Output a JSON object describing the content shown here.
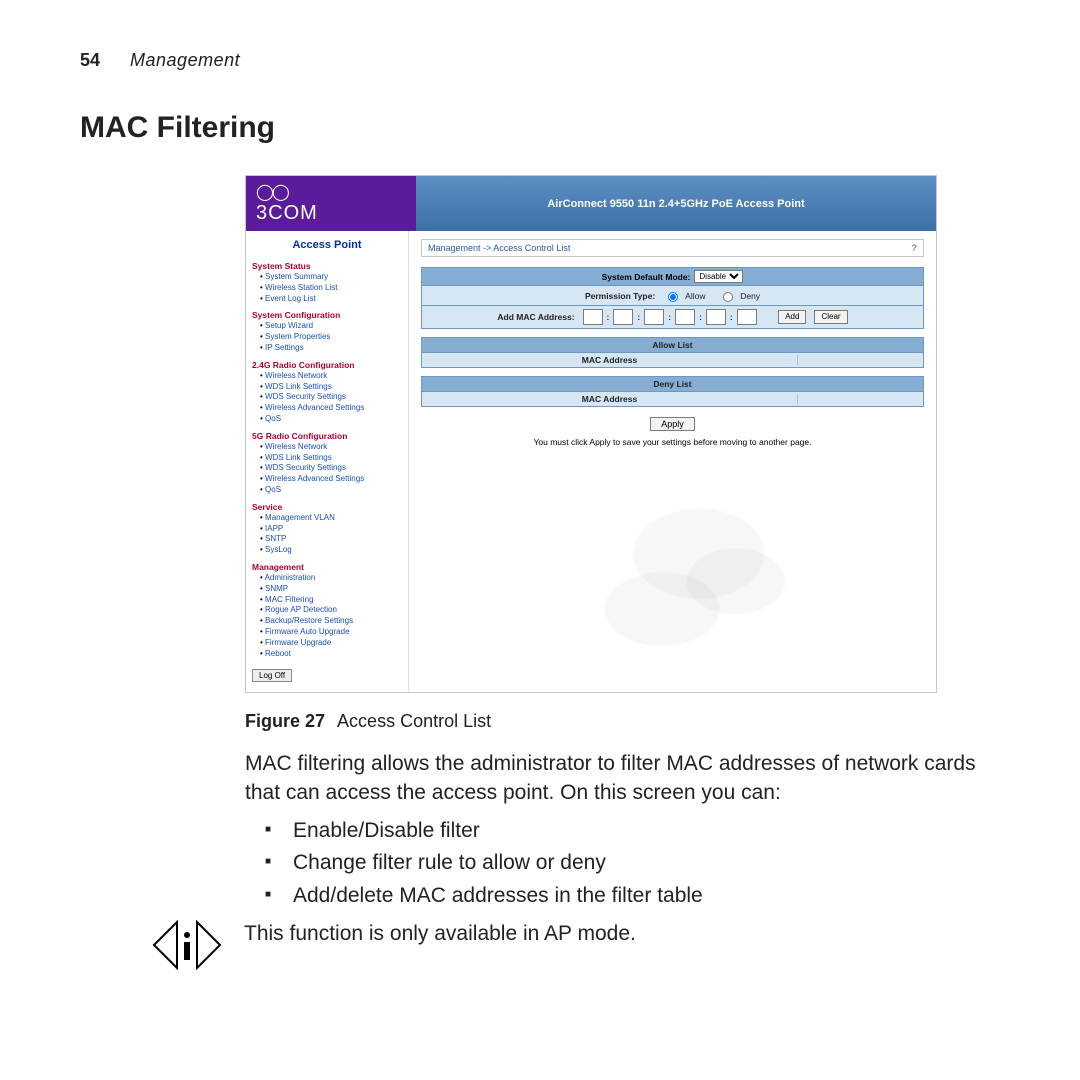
{
  "page": {
    "number": "54",
    "chapter": "Management",
    "section_heading": "MAC Filtering"
  },
  "screenshot": {
    "brand": "3COM",
    "product_title": "AirConnect 9550 11n 2.4+5GHz PoE Access Point",
    "sidebar_title": "Access Point",
    "logoff": "Log Off",
    "nav": [
      {
        "group": "System Status",
        "items": [
          "System Summary",
          "Wireless Station List",
          "Event Log List"
        ]
      },
      {
        "group": "System Configuration",
        "items": [
          "Setup Wizard",
          "System Properties",
          "IP Settings"
        ]
      },
      {
        "group": "2.4G Radio Configuration",
        "items": [
          "Wireless Network",
          "WDS Link Settings",
          "WDS Security Settings",
          "Wireless Advanced Settings",
          "QoS"
        ]
      },
      {
        "group": "5G Radio Configuration",
        "items": [
          "Wireless Network",
          "WDS Link Settings",
          "WDS Security Settings",
          "Wireless Advanced Settings",
          "QoS"
        ]
      },
      {
        "group": "Service",
        "items": [
          "Management VLAN",
          "IAPP",
          "SNTP",
          "SysLog"
        ]
      },
      {
        "group": "Management",
        "items": [
          "Administration",
          "SNMP",
          "MAC Filtering",
          "Rogue AP Detection",
          "Backup/Restore Settings",
          "Firmware Auto Upgrade",
          "Firmware Upgrade",
          "Reboot"
        ]
      }
    ],
    "breadcrumb": "Management -> Access Control List",
    "help": "?",
    "default_mode_label": "System Default Mode:",
    "default_mode_value": "Disable",
    "permission_label": "Permission Type:",
    "permission_allow": "Allow",
    "permission_deny": "Deny",
    "add_mac_label": "Add MAC Address:",
    "btn_add": "Add",
    "btn_clear": "Clear",
    "allow_list_header": "Allow List",
    "deny_list_header": "Deny List",
    "col_mac": "MAC Address",
    "btn_apply": "Apply",
    "apply_note": "You must click Apply to save your settings before moving to another page."
  },
  "caption": {
    "label": "Figure 27",
    "text": "Access Control List"
  },
  "body": {
    "intro": "MAC filtering allows the administrator to filter MAC addresses of network cards that can access the access point. On this screen you can:",
    "bullets": [
      "Enable/Disable filter",
      "Change filter rule to allow or deny",
      "Add/delete MAC addresses in the filter table"
    ],
    "note": "This function is only available in AP mode."
  }
}
